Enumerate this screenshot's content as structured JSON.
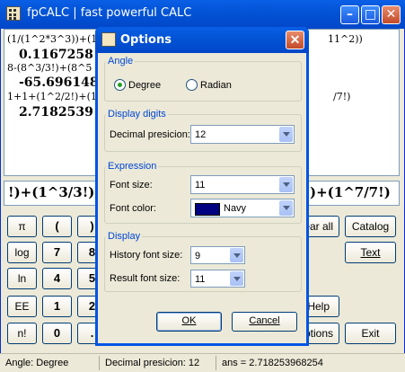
{
  "main": {
    "title": "fpCALC | fast powerful CALC",
    "history": [
      {
        "expr": "(1/(1^2*3^3))+(1/(1",
        "expr_right": "11^2))",
        "result": "0.1167258"
      },
      {
        "expr": "8-(8^3/3!)+(8^5",
        "expr_right": "",
        "result": "-65.696148"
      },
      {
        "expr": "1+1+(1^2/2!)+(1^",
        "expr_right": "/7!)",
        "result": "2.7182539"
      }
    ],
    "expression_left": "!)+(1^3/3!)",
    "expression_right": ")+(1^7/7!)",
    "keys": {
      "pi": "π",
      "lparen": "(",
      "rparen": ")",
      "log": "log",
      "seven": "7",
      "eight": "8",
      "ln": "ln",
      "four": "4",
      "five": "5",
      "ee": "EE",
      "one": "1",
      "two": "2",
      "fact": "n!",
      "zero": "0",
      "dot": "."
    },
    "right_buttons": {
      "clear_all": "ear all",
      "catalog": "Catalog",
      "text": "Text",
      "help": "Help",
      "options": "ptions",
      "exit": "Exit"
    },
    "status": {
      "angle": "Angle: Degree",
      "precision": "Decimal presicion: 12",
      "ans": "ans = 2.718253968254"
    }
  },
  "dialog": {
    "title": "Options",
    "angle": {
      "group_label": "Angle",
      "degree": "Degree",
      "radian": "Radian",
      "selected": "Degree"
    },
    "display_digits": {
      "group_label": "Display digits",
      "label": "Decimal presicion:",
      "value": "12"
    },
    "expression": {
      "group_label": "Expression",
      "font_size_label": "Font size:",
      "font_size_value": "11",
      "font_color_label": "Font color:",
      "font_color_value": "Navy",
      "font_color_hex": "#000080"
    },
    "display": {
      "group_label": "Display",
      "history_label": "History font size:",
      "history_value": "9",
      "result_label": "Result font size:",
      "result_value": "11"
    },
    "ok": "OK",
    "cancel": "Cancel"
  }
}
